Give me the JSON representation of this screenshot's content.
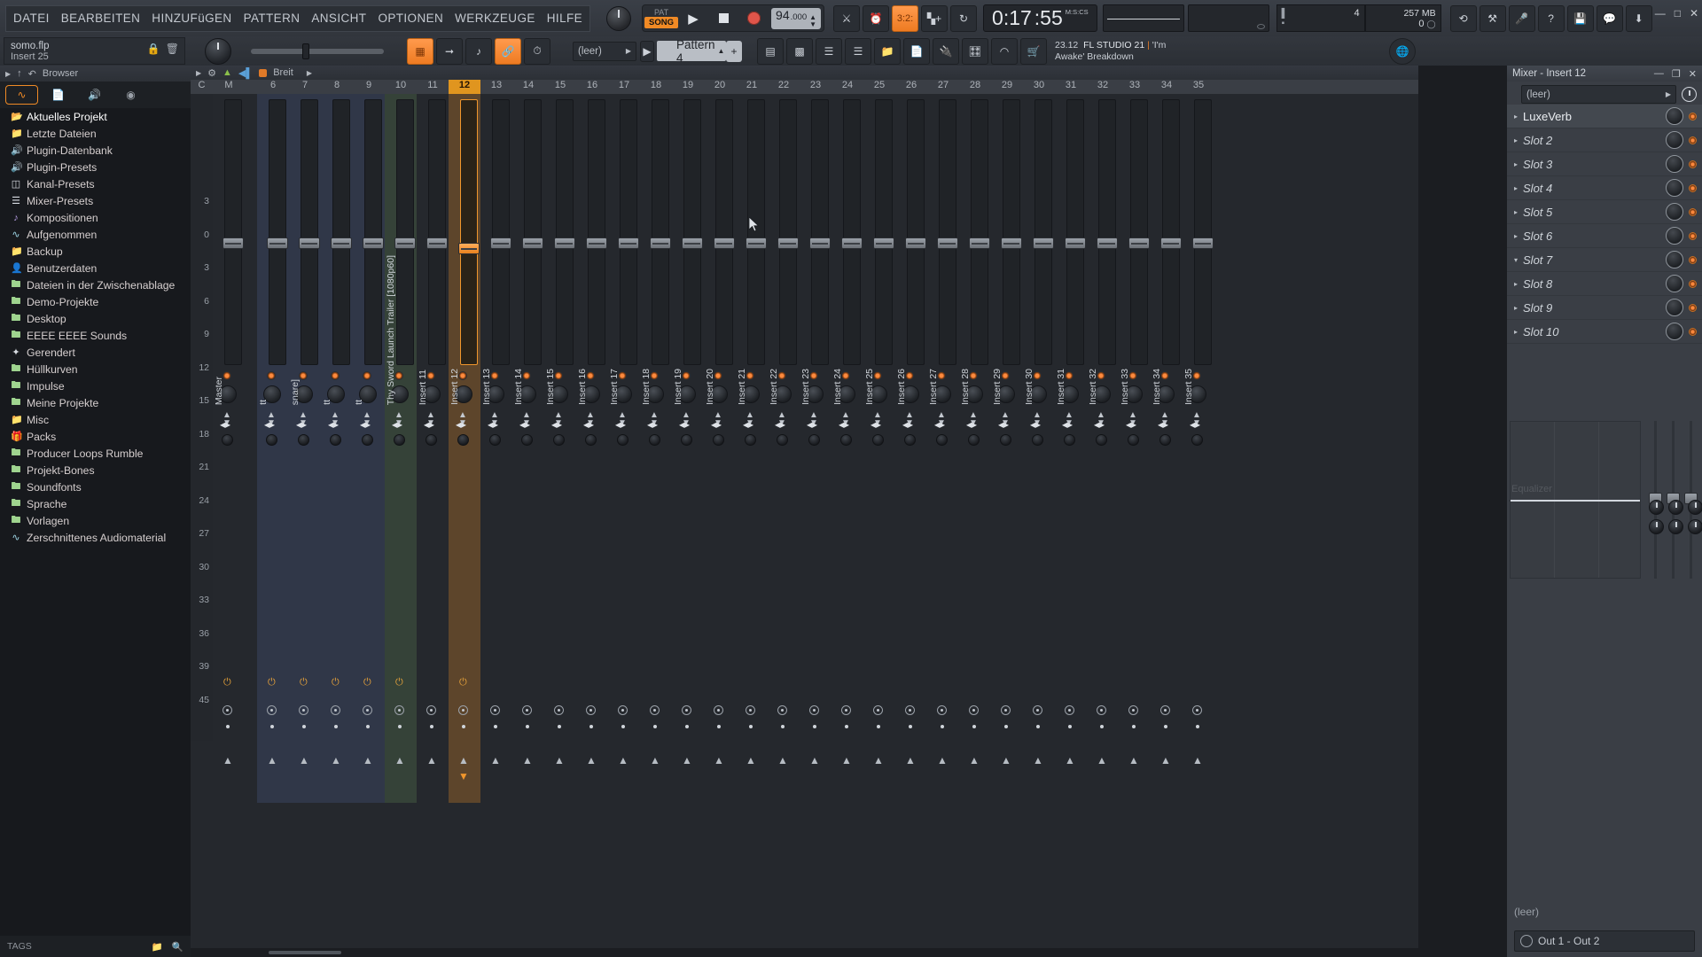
{
  "menu": {
    "items": [
      "DATEI",
      "BEARBEITEN",
      "HINZUFüGEN",
      "PATTERN",
      "ANSICHT",
      "OPTIONEN",
      "WERKZEUGE",
      "HILFE"
    ]
  },
  "transport": {
    "pat_label": "PAT",
    "song_label": "SONG",
    "tempo_int": "94",
    "tempo_dec": ".000",
    "time_big": "0:17",
    "time_sec": ":55",
    "time_unit": "M:S:CS",
    "snap_value": "3:2:",
    "pattern_count": "4",
    "memory": "257 MB",
    "cpu": "0"
  },
  "project": {
    "file": "somo.flp",
    "insert": "Insert 25"
  },
  "channel_bar": {
    "preset_select": "(leer)",
    "pattern_name": "Pattern 4",
    "plus": "+",
    "version_line1_num": "23.12",
    "version_line1": "FL STUDIO 21",
    "version_sep": "|",
    "version_song1": "'I'm",
    "version_song2": "Awake' Breakdown"
  },
  "browser": {
    "title": "Browser",
    "tabs": [
      "wave-icon",
      "file-icon",
      "plug-icon",
      "globe-icon"
    ],
    "tag_label": "TAGS",
    "items": [
      {
        "label": "Aktuelles Projekt",
        "icon": "folder-open",
        "hl": true
      },
      {
        "label": "Letzte Dateien",
        "icon": "folder-recent"
      },
      {
        "label": "Plugin-Datenbank",
        "icon": "plug"
      },
      {
        "label": "Plugin-Presets",
        "icon": "plug"
      },
      {
        "label": "Kanal-Presets",
        "icon": "channel"
      },
      {
        "label": "Mixer-Presets",
        "icon": "mixer"
      },
      {
        "label": "Kompositionen",
        "icon": "note"
      },
      {
        "label": "Aufgenommen",
        "icon": "wave"
      },
      {
        "label": "Backup",
        "icon": "folder-recent"
      },
      {
        "label": "Benutzerdaten",
        "icon": "user"
      },
      {
        "label": "Dateien in der Zwischenablage",
        "icon": "folder-link"
      },
      {
        "label": "Demo-Projekte",
        "icon": "folder-link"
      },
      {
        "label": "Desktop",
        "icon": "folder-link"
      },
      {
        "label": "EEEE EEEE Sounds",
        "icon": "folder-link"
      },
      {
        "label": "Gerendert",
        "icon": "render"
      },
      {
        "label": "Hüllkurven",
        "icon": "folder-link"
      },
      {
        "label": "Impulse",
        "icon": "folder-link"
      },
      {
        "label": "Meine Projekte",
        "icon": "folder-link"
      },
      {
        "label": "Misc",
        "icon": "folder"
      },
      {
        "label": "Packs",
        "icon": "packs"
      },
      {
        "label": "Producer Loops Rumble",
        "icon": "folder-link"
      },
      {
        "label": "Projekt-Bones",
        "icon": "folder-link"
      },
      {
        "label": "Soundfonts",
        "icon": "folder-link"
      },
      {
        "label": "Sprache",
        "icon": "folder-link"
      },
      {
        "label": "Vorlagen",
        "icon": "folder-link"
      },
      {
        "label": "Zerschnittenes Audiomaterial",
        "icon": "wave"
      }
    ]
  },
  "mixer": {
    "header_title": "Breit",
    "scale_ticks": [
      "3",
      "0",
      "3",
      "6",
      "9",
      "12",
      "15",
      "18",
      "21",
      "24",
      "27",
      "30",
      "33",
      "36",
      "39",
      "45"
    ],
    "col_headers": [
      "C",
      "M",
      "6",
      "7",
      "8",
      "9",
      "10",
      "11",
      "12",
      "13",
      "14",
      "15",
      "16",
      "17",
      "18",
      "19",
      "20",
      "21",
      "22",
      "23",
      "24",
      "25",
      "26",
      "27",
      "28",
      "29",
      "30",
      "31",
      "32",
      "33",
      "34",
      "35"
    ],
    "selected_track": "12",
    "tracks": [
      {
        "num": "M",
        "name": "Master",
        "tint": "none"
      },
      {
        "num": "6",
        "name": "tt",
        "tint": "blue"
      },
      {
        "num": "7",
        "name": "snare]",
        "tint": "blue"
      },
      {
        "num": "8",
        "name": "tt",
        "tint": "blue"
      },
      {
        "num": "9",
        "name": "tt",
        "tint": "blue"
      },
      {
        "num": "10",
        "name": "Thy Sword Launch Trailer [1080p60]",
        "tint": "green"
      },
      {
        "num": "11",
        "name": "Insert 11",
        "tint": "none"
      },
      {
        "num": "12",
        "name": "Insert 12",
        "tint": "orange",
        "selected": true
      },
      {
        "num": "13",
        "name": "Insert 13",
        "tint": "none"
      },
      {
        "num": "14",
        "name": "Insert 14",
        "tint": "none"
      },
      {
        "num": "15",
        "name": "Insert 15",
        "tint": "none"
      },
      {
        "num": "16",
        "name": "Insert 16",
        "tint": "none"
      },
      {
        "num": "17",
        "name": "Insert 17",
        "tint": "none"
      },
      {
        "num": "18",
        "name": "Insert 18",
        "tint": "none"
      },
      {
        "num": "19",
        "name": "Insert 19",
        "tint": "none"
      },
      {
        "num": "20",
        "name": "Insert 20",
        "tint": "none"
      },
      {
        "num": "21",
        "name": "Insert 21",
        "tint": "none"
      },
      {
        "num": "22",
        "name": "Insert 22",
        "tint": "none"
      },
      {
        "num": "23",
        "name": "Insert 23",
        "tint": "none"
      },
      {
        "num": "24",
        "name": "Insert 24",
        "tint": "none"
      },
      {
        "num": "25",
        "name": "Insert 25",
        "tint": "none"
      },
      {
        "num": "26",
        "name": "Insert 26",
        "tint": "none"
      },
      {
        "num": "27",
        "name": "Insert 27",
        "tint": "none"
      },
      {
        "num": "28",
        "name": "Insert 28",
        "tint": "none"
      },
      {
        "num": "29",
        "name": "Insert 29",
        "tint": "none"
      },
      {
        "num": "30",
        "name": "Insert 30",
        "tint": "none"
      },
      {
        "num": "31",
        "name": "Insert 31",
        "tint": "none"
      },
      {
        "num": "32",
        "name": "Insert 32",
        "tint": "none"
      },
      {
        "num": "33",
        "name": "Insert 33",
        "tint": "none"
      },
      {
        "num": "34",
        "name": "Insert 34",
        "tint": "none"
      },
      {
        "num": "35",
        "name": "Insert 35",
        "tint": "none"
      }
    ]
  },
  "insert_panel": {
    "title": "Mixer - Insert 12",
    "preset": "(leer)",
    "slots": [
      {
        "label": "LuxeVerb",
        "active": true,
        "expanded": false
      },
      {
        "label": "Slot 2",
        "active": false,
        "expanded": false
      },
      {
        "label": "Slot 3",
        "active": false,
        "expanded": false
      },
      {
        "label": "Slot 4",
        "active": false,
        "expanded": false
      },
      {
        "label": "Slot 5",
        "active": false,
        "expanded": false
      },
      {
        "label": "Slot 6",
        "active": false,
        "expanded": false
      },
      {
        "label": "Slot 7",
        "active": false,
        "expanded": true
      },
      {
        "label": "Slot 8",
        "active": false,
        "expanded": false
      },
      {
        "label": "Slot 9",
        "active": false,
        "expanded": false
      },
      {
        "label": "Slot 10",
        "active": false,
        "expanded": false
      }
    ],
    "eq_label": "Equalizer",
    "footer_empty": "(leer)",
    "output": "Out 1 - Out 2"
  },
  "colors": {
    "accent": "#f08a25",
    "panel": "#25282d",
    "toolbar": "#33373e",
    "browser_bg": "#17191d"
  }
}
